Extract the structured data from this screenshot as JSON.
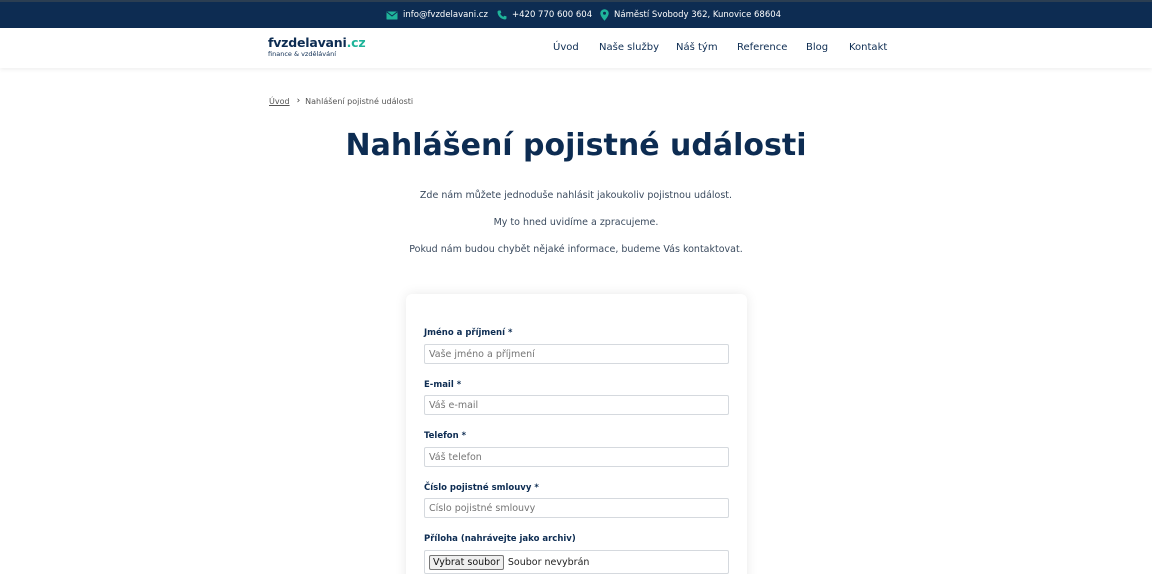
{
  "topbar": {
    "email": "info@fvzdelavani.cz",
    "phone": "+420 770 600 604",
    "address": "Náměstí Svobody 362, Kunovice 68604",
    "icons": [
      "mail-icon",
      "phone-icon",
      "location-pin-icon"
    ],
    "icon_color": "#1fb49a",
    "background": "#0d2c52"
  },
  "brand": {
    "name_main": "fvzdelavani",
    "name_tld": ".cz",
    "tagline": "finance & vzdělávání",
    "accent_color": "#1fb49a"
  },
  "nav": {
    "items": [
      "Úvod",
      "Naše služby",
      "Náš tým",
      "Reference",
      "Blog",
      "Kontakt"
    ]
  },
  "breadcrumb": {
    "home": "Úvod",
    "current": "Nahlášení pojistné události"
  },
  "page": {
    "title": "Nahlášení pojistné události",
    "intro": [
      "Zde nám můžete jednoduše nahlásit jakoukoliv pojistnou událost.",
      "My to hned uvidíme a zpracujeme.",
      "Pokud nám budou chybět nějaké informace, budeme Vás kontaktovat."
    ]
  },
  "form": {
    "fields": [
      {
        "label": "Jméno a příjmení *",
        "placeholder": "Vaše jméno a příjmení"
      },
      {
        "label": "E-mail *",
        "placeholder": "Váš e-mail"
      },
      {
        "label": "Telefon *",
        "placeholder": "Váš telefon"
      },
      {
        "label": "Číslo pojistné smlouvy *",
        "placeholder": "Číslo pojistné smlouvy"
      }
    ],
    "attachment": {
      "label": "Příloha (nahrávejte jako archiv)",
      "button": "Vybrat soubor",
      "status": "Soubor nevybrán"
    }
  }
}
